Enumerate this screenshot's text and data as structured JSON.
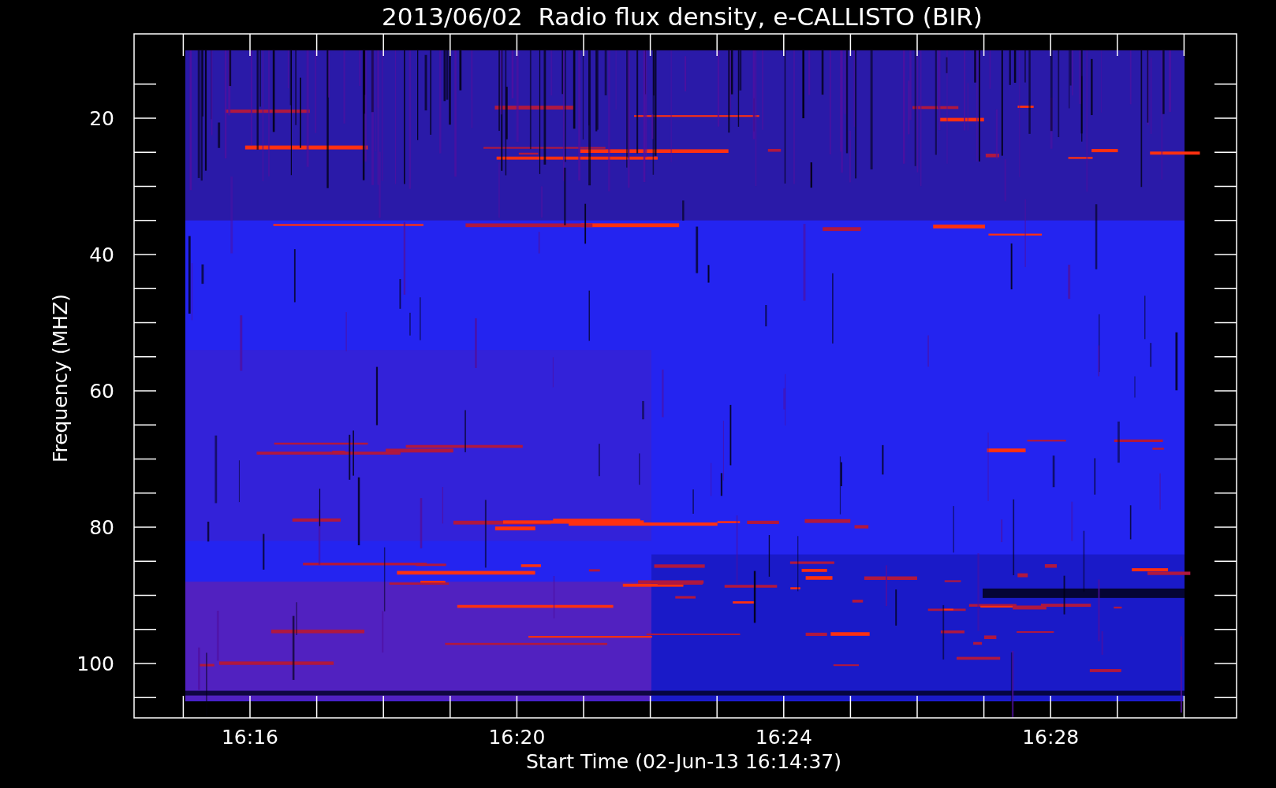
{
  "title": "2013/06/02  Radio flux density, e-CALLISTO (BIR)",
  "y_axis": {
    "label": "Frequency (MHZ)",
    "ticks": [
      "20",
      "40",
      "60",
      "80",
      "100"
    ]
  },
  "x_axis": {
    "label": "Start Time (02-Jun-13 16:14:37)",
    "ticks": [
      "16:16",
      "16:20",
      "16:24",
      "16:28"
    ]
  }
}
